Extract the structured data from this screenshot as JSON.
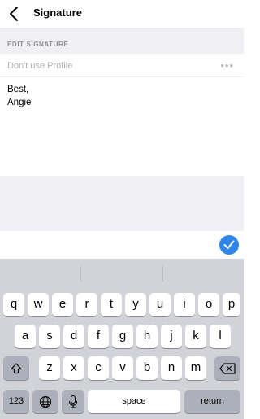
{
  "nav": {
    "title": "Signature"
  },
  "section": {
    "label": "EDIT SIGNATURE"
  },
  "signature": {
    "selector_text": "Don't use Profile",
    "more_label": "•••",
    "body": "Best,\nAngie"
  },
  "keyboard": {
    "row1": [
      "q",
      "w",
      "e",
      "r",
      "t",
      "y",
      "u",
      "i",
      "o",
      "p"
    ],
    "row2": [
      "a",
      "s",
      "d",
      "f",
      "g",
      "h",
      "j",
      "k",
      "l"
    ],
    "row3": [
      "z",
      "x",
      "c",
      "v",
      "b",
      "n",
      "m"
    ],
    "numbers_label": "123",
    "space_label": "space",
    "return_label": "return"
  },
  "icons": {
    "back": "chevron-left-icon",
    "done": "checkmark-icon",
    "shift": "shift-arrow-icon",
    "delete": "backspace-icon",
    "globe": "globe-icon",
    "mic": "microphone-icon"
  },
  "colors": {
    "accent": "#2f86ea",
    "keyboard_bg": "#d1d3d9",
    "section_bg": "#efeff4"
  }
}
